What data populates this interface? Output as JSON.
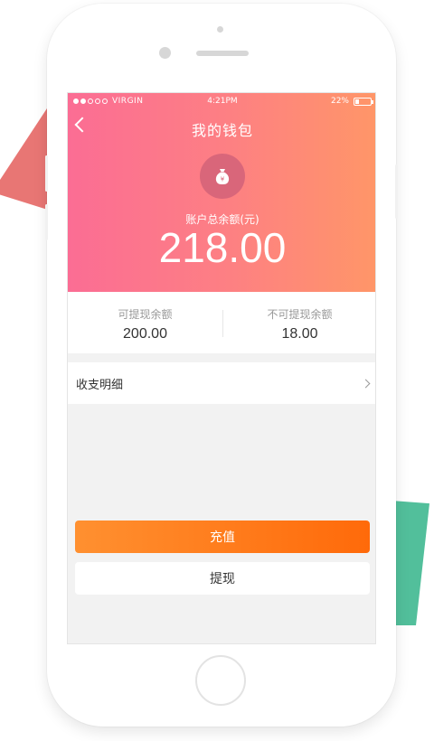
{
  "status_bar": {
    "carrier": "VIRGIN",
    "time": "4:21PM",
    "battery_percent": "22%",
    "battery_level": 0.22
  },
  "header": {
    "title": "我的钱包",
    "wallet_icon_glyph": "¥"
  },
  "balance": {
    "label": "账户总余额(元)",
    "value": "218.00"
  },
  "withdrawable": {
    "label": "可提现余额",
    "value": "200.00"
  },
  "non_withdrawable": {
    "label": "不可提现余额",
    "value": "18.00"
  },
  "detail": {
    "label": "收支明细"
  },
  "actions": {
    "recharge_label": "充值",
    "withdraw_label": "提现"
  },
  "colors": {
    "gradient_start": "#fb6d94",
    "gradient_end": "#ff9668",
    "recharge_start": "#ff9030",
    "recharge_end": "#ff6a0a",
    "deco_red": "#e87674",
    "deco_green": "#52bf9b"
  }
}
